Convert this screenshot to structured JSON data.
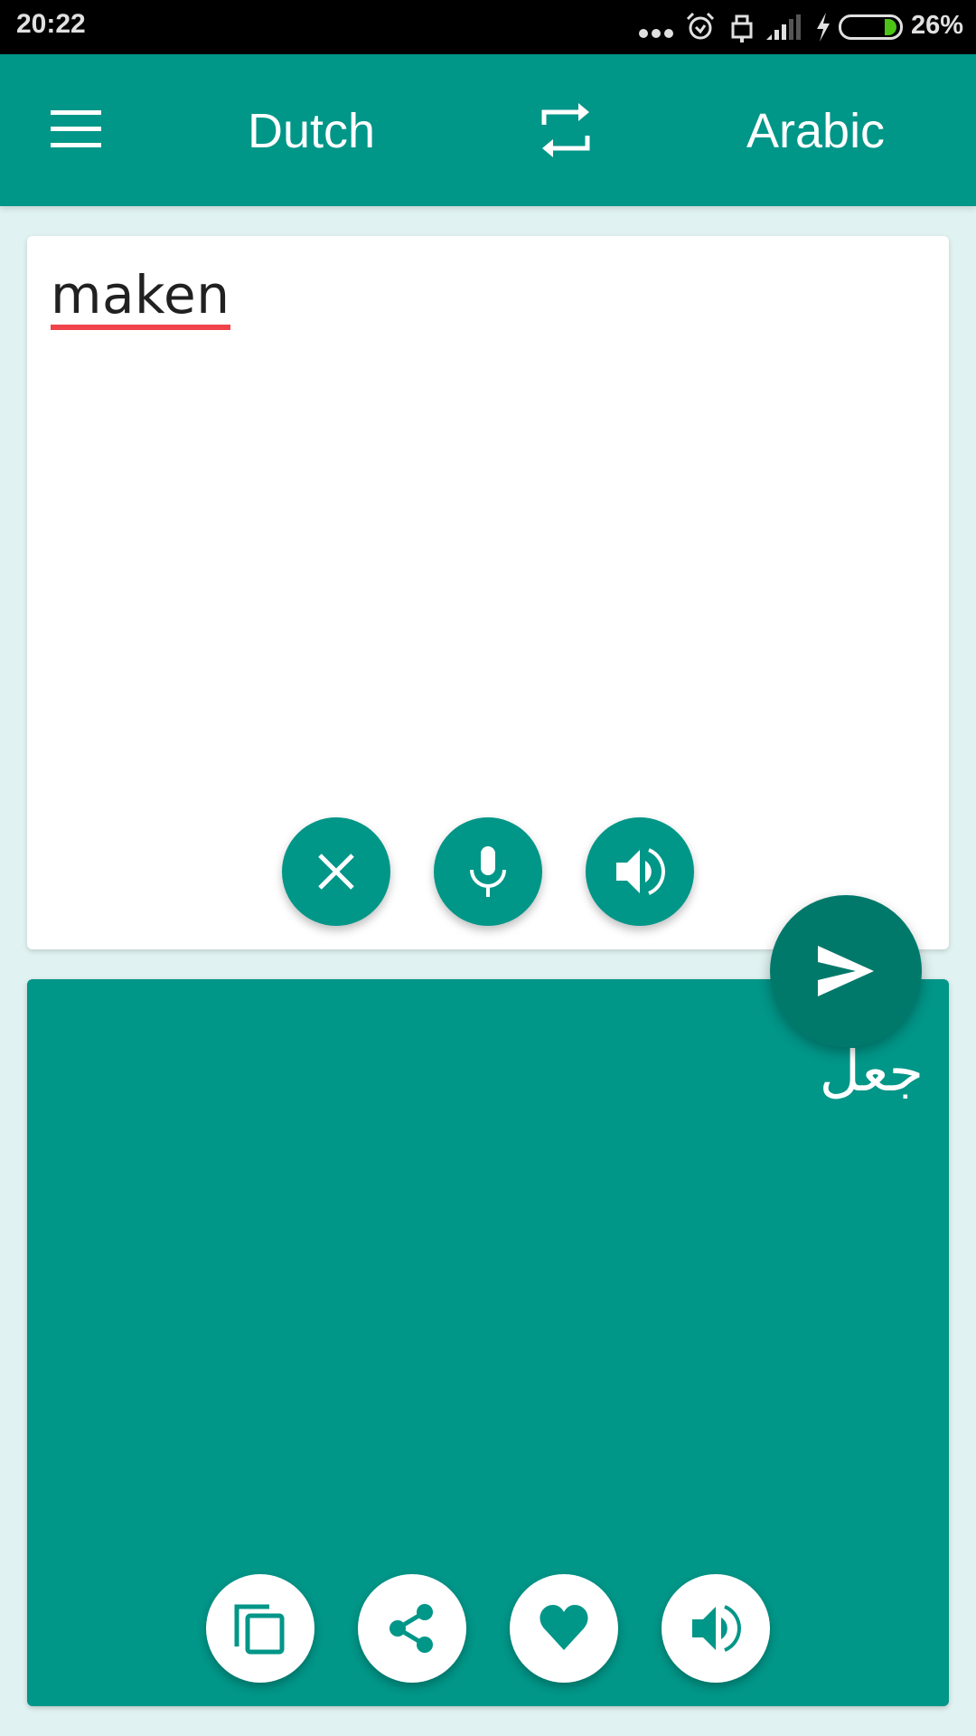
{
  "status_bar": {
    "time": "20:22",
    "battery_percent": "26%",
    "battery_level": 0.26,
    "icons": [
      "more-dots-icon",
      "alarm-icon",
      "usb-icon",
      "signal-icon",
      "charging-icon",
      "battery-icon"
    ]
  },
  "toolbar": {
    "menu_icon": "hamburger-menu-icon",
    "source_language": "Dutch",
    "swap_icon": "swap-languages-icon",
    "target_language": "Arabic"
  },
  "input_card": {
    "text": "maken",
    "buttons": [
      {
        "name": "clear",
        "icon": "close-icon"
      },
      {
        "name": "voice-input",
        "icon": "microphone-icon"
      },
      {
        "name": "speak-source",
        "icon": "speaker-icon"
      }
    ]
  },
  "translate_button": {
    "icon": "send-icon"
  },
  "output_card": {
    "text": "جعل",
    "buttons": [
      {
        "name": "copy",
        "icon": "copy-icon"
      },
      {
        "name": "share",
        "icon": "share-icon"
      },
      {
        "name": "favorite",
        "icon": "heart-icon"
      },
      {
        "name": "speak-translation",
        "icon": "speaker-icon"
      }
    ]
  },
  "colors": {
    "primary": "#009688",
    "primary_dark": "#00796b",
    "background": "#e0f2f1",
    "spellcheck_underline": "#f0444a",
    "battery_fill": "#4cc417"
  }
}
